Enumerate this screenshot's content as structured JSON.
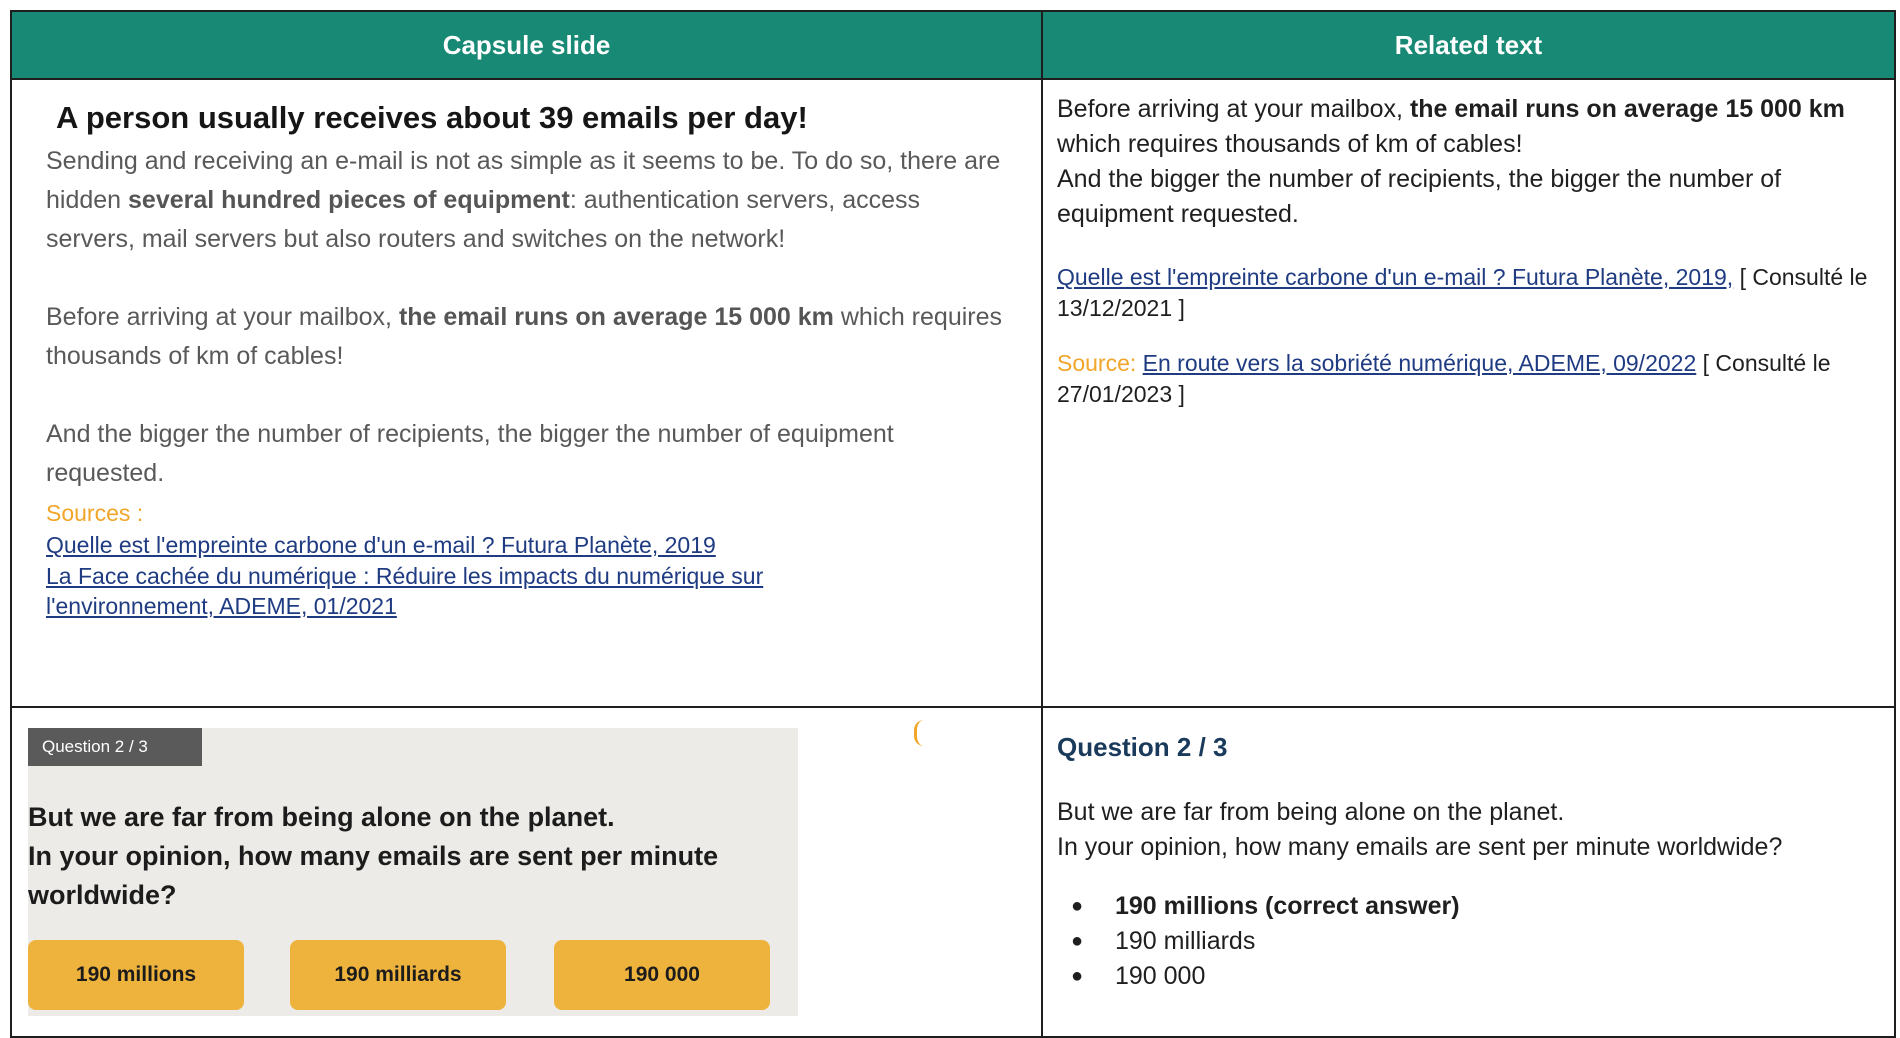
{
  "header": {
    "col1": "Capsule slide",
    "col2": "Related text"
  },
  "row1": {
    "slide": {
      "title": "A person usually receives about 39 emails per day!",
      "p1_pre": "Sending and receiving an e-mail is not as simple as it seems to be. To do so, there are hidden ",
      "p1_bold": "several hundred pieces of equipment",
      "p1_post": ": authentication servers, access servers, mail servers but also routers and switches on the network!",
      "p2_pre": "Before arriving at your mailbox, ",
      "p2_bold": "the email runs on average 15 000 km",
      "p2_post": " which requires thousands of km of cables!",
      "p3": "And the bigger the number of recipients, the bigger the number of equipment requested.",
      "sources_label": "Sources :",
      "source1": "Quelle est l'empreinte carbone d'un e-mail ? Futura Planète, 2019",
      "source2": "La Face cachée du numérique : Réduire les impacts du numérique sur l'environnement, ADEME, 01/2021"
    },
    "text": {
      "p1_pre": "Before arriving at your mailbox, ",
      "p1_bold": "the email runs on average 15 000 km",
      "p1_post": " which requires thousands of km of cables!",
      "p2": "And the bigger the number of recipients, the bigger the number of equipment requested.",
      "ref1_link": "Quelle est l'empreinte carbone d'un e-mail ? Futura Planète, 2019,",
      "ref1_tail": " [ Consulté le 13/12/2021 ]",
      "source_label": "Source: ",
      "ref2_link": "En route vers la sobriété numérique, ADEME, 09/2022",
      "ref2_tail": " [ Consulté le 27/01/2023 ]"
    }
  },
  "row2": {
    "slide": {
      "tag": "Question 2 / 3",
      "line1": "But we are far from being alone on the planet.",
      "line2": "In your opinion, how many emails are sent per minute worldwide?",
      "answers": [
        "190 millions",
        "190 milliards",
        "190 000"
      ]
    },
    "text": {
      "title": "Question 2 / 3",
      "line1": "But we are far from being alone on the planet.",
      "line2": "In your opinion, how many emails are sent per minute worldwide?",
      "options": [
        "190 millions (correct answer)",
        "190 milliards",
        "190 000"
      ]
    }
  },
  "colors": {
    "header_bg": "#188974",
    "accent_orange": "#f1a529",
    "answer_button": "#eeb33c",
    "link": "#1f3b82"
  }
}
